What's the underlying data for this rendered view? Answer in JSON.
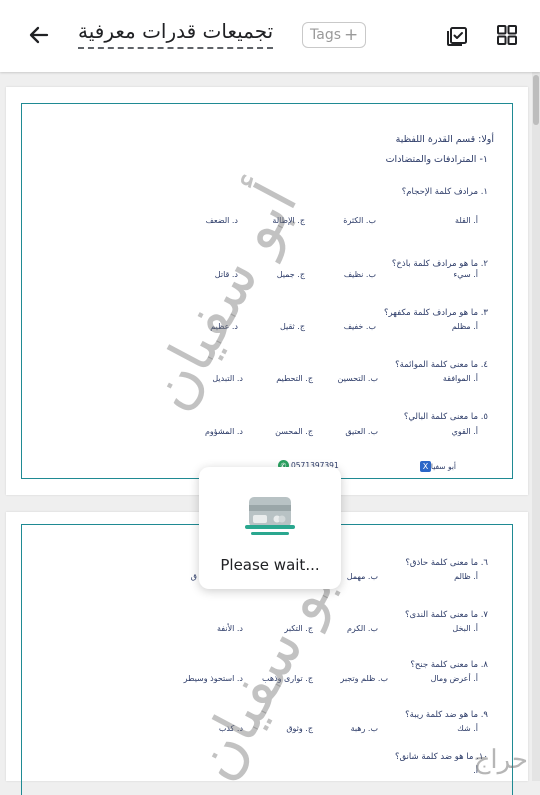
{
  "header": {
    "title": "تجميعات قدرات معرفية",
    "tags_label": "Tags"
  },
  "icons": {
    "back": "back-arrow-icon",
    "tags_add": "plus-icon",
    "select": "checkbox-stack-icon",
    "grid": "grid-icon",
    "loading": "card-payment-icon"
  },
  "colors": {
    "frame": "#1f8a93",
    "doc_text": "#2b3a67",
    "accent_green": "#2aa160"
  },
  "page1": {
    "heading": "أولا: قسم القدرة اللفظية",
    "subheading": "١- المترادفات والمتضادات",
    "questions": [
      {
        "q": "١. مرادف كلمة الإحجام؟",
        "opts": [
          "أ.  القلة",
          "ب. الكثرة",
          "ج. الإطالة",
          "د. الضعف"
        ]
      },
      {
        "q": "٢. ما هو مرادف كلمة باذخ؟",
        "opts": [
          "أ.  سيء",
          "ب. نظيف",
          "ج. جميل",
          "د.  قاتل"
        ]
      },
      {
        "q": "٣. ما هو مرادف كلمة مكفهر؟",
        "opts": [
          "أ.  مظلم",
          "ب. خفيف",
          "ج. ثقيل",
          "د. عظيم"
        ]
      },
      {
        "q": "٤. ما معنى كلمة الموائمة؟",
        "opts": [
          "أ.  الموافقة",
          "ب. التحسين",
          "ج. التحطيم",
          "د. التبديل"
        ]
      },
      {
        "q": "٥. ما معنى كلمة البالي؟",
        "opts": [
          "أ.  القوي",
          "ب. العتيق",
          "ج. المحسن",
          "د. المشؤوم"
        ]
      }
    ],
    "footer_name": "أبو سفيان",
    "footer_phone": "0571397391"
  },
  "page2": {
    "questions": [
      {
        "q": "٦. ما معنى كلمة حاذق؟",
        "opts": [
          "أ.  ظالم",
          "ب. مهمل",
          "",
          "ق"
        ]
      },
      {
        "q": "٧. ما معنى كلمة الندى؟",
        "opts": [
          "أ.  البخل",
          "ب. الكرم",
          "ج. التكبر",
          "د. الأنفة"
        ]
      },
      {
        "q": "٨. ما معنى كلمة جنح؟",
        "opts": [
          "أ.  أعرض ومال",
          "ب. ظلم وتجبر",
          "ج. توارى وذهب",
          "د. استحوذ وسيطر"
        ]
      },
      {
        "q": "٩. ما هو ضد كلمة ريبة؟",
        "opts": [
          "أ.  شك",
          "ب. رهبة",
          "ج. وثوق",
          "د. كذب"
        ]
      },
      {
        "q": "١٠. ما هو ضد كلمة شانق؟",
        "opts": [
          "أ.",
          "",
          "",
          ""
        ]
      }
    ]
  },
  "watermark_text": "أبو سفيان",
  "loading": {
    "label": "Please wait..."
  },
  "corner_logo": "حراج"
}
